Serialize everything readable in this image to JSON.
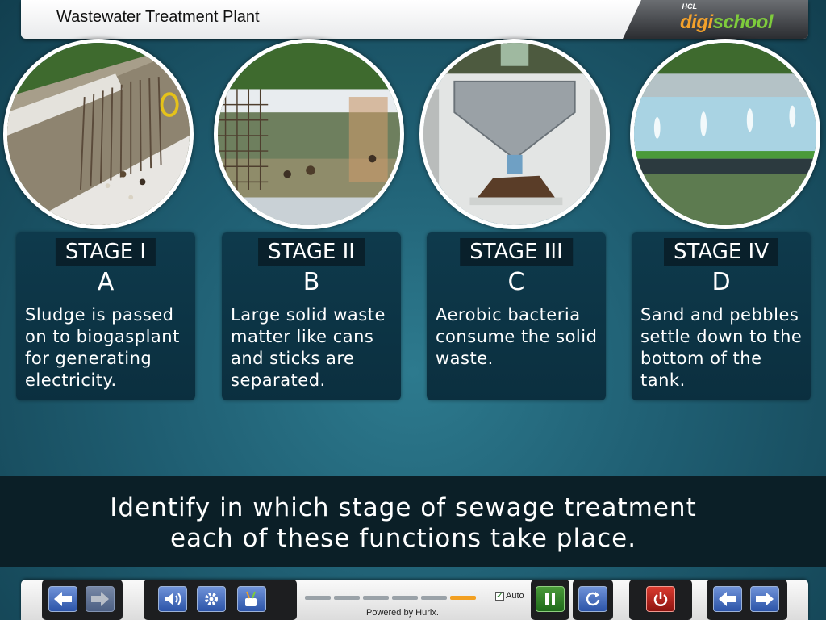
{
  "header": {
    "title": "Wastewater Treatment Plant",
    "logo": {
      "prefix": "HCL",
      "part1": "digi",
      "part2": "school"
    }
  },
  "stages": [
    {
      "label": "STAGE I",
      "letter": "A",
      "description": "Sludge is passed on to biogasplant for generating electricity."
    },
    {
      "label": "STAGE II",
      "letter": "B",
      "description": "Large solid waste matter like cans and sticks are separated."
    },
    {
      "label": "STAGE III",
      "letter": "C",
      "description": "Aerobic bacteria consume the solid waste."
    },
    {
      "label": "STAGE IV",
      "letter": "D",
      "description": "Sand and pebbles settle down to the bottom of the tank."
    }
  ],
  "instruction": {
    "line1": "Identify in which stage of sewage treatment",
    "line2": "each of these functions take place."
  },
  "toolbar": {
    "auto_label": "Auto",
    "auto_checked": true,
    "powered_by": "Powered by Hurix.",
    "progress_segments": 6,
    "progress_active_index": 5,
    "icons": [
      "back-arrow-icon",
      "forward-arrow-icon",
      "speaker-icon",
      "gear-icon",
      "tools-icon",
      "pause-icon",
      "replay-icon",
      "power-icon",
      "prev-page-icon",
      "next-page-icon"
    ]
  },
  "colors": {
    "background": "#1f5e72",
    "card": "#0e3a4c",
    "accent_orange": "#f2a022",
    "logo_orange": "#f3a12b",
    "logo_green": "#7ecb3c"
  }
}
